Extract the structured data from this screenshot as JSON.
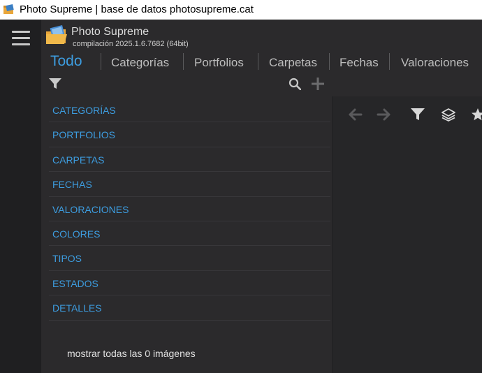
{
  "window": {
    "title": "Photo Supreme | base de datos photosupreme.cat"
  },
  "header": {
    "app_name": "Photo Supreme",
    "build": "compilación 2025.1.6.7682 (64bit)"
  },
  "tabs": [
    {
      "label": "Todo",
      "active": true
    },
    {
      "label": "Categorías"
    },
    {
      "label": "Portfolios"
    },
    {
      "label": "Carpetas"
    },
    {
      "label": "Fechas"
    },
    {
      "label": "Valoraciones"
    }
  ],
  "list": {
    "items": [
      {
        "label": "CATEGORÍAS"
      },
      {
        "label": "PORTFOLIOS"
      },
      {
        "label": "CARPETAS"
      },
      {
        "label": "FECHAS"
      },
      {
        "label": "VALORACIONES"
      },
      {
        "label": "COLORES"
      },
      {
        "label": "TIPOS"
      },
      {
        "label": "ESTADOS"
      },
      {
        "label": "DETALLES"
      }
    ]
  },
  "footer": {
    "show_all": "mostrar todas las 0 imágenes"
  },
  "colors": {
    "accent": "#3d9de0",
    "background": "#2b2a2c",
    "rail": "#1f1f21"
  },
  "icons": [
    "app-icon",
    "hamburger-menu-icon",
    "filter-icon",
    "search-icon",
    "add-icon",
    "back-arrow-icon",
    "forward-arrow-icon",
    "stack-icon",
    "star-icon"
  ]
}
